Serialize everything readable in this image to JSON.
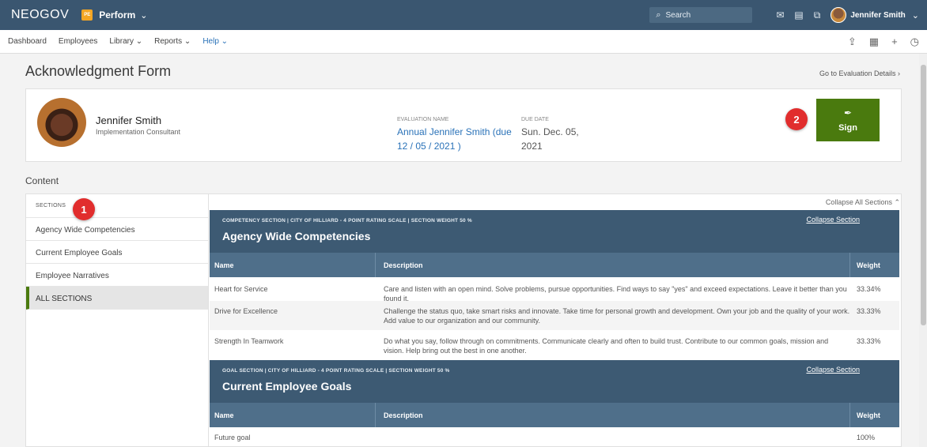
{
  "topbar": {
    "brand": "NEOGOV",
    "app_badge": "PE",
    "app_name": "Perform",
    "search_placeholder": "Search",
    "user_name": "Jennifer Smith"
  },
  "nav": {
    "items": [
      "Dashboard",
      "Employees",
      "Library",
      "Reports"
    ],
    "help": "Help"
  },
  "page": {
    "title": "Acknowledgment Form",
    "eval_link": "Go to Evaluation Details"
  },
  "employee": {
    "name": "Jennifer Smith",
    "role": "Implementation Consultant"
  },
  "evaluation": {
    "name_label": "EVALUATION NAME",
    "name_value": "Annual Jennifer Smith (due 12 / 05 / 2021 )",
    "due_label": "DUE DATE",
    "due_value": "Sun. Dec. 05, 2021"
  },
  "sign_label": "Sign",
  "badges": [
    "1",
    "2"
  ],
  "content_label": "Content",
  "sections_panel": {
    "header": "SECTIONS",
    "items": [
      "Agency Wide Competencies",
      "Current Employee Goals",
      "Employee Narratives",
      "ALL SECTIONS"
    ]
  },
  "collapse_all": "Collapse All Sections",
  "competency": {
    "subtitle": "COMPETENCY SECTION | CITY OF HILLIARD - 4 POINT RATING SCALE | SECTION WEIGHT 50 %",
    "title": "Agency Wide Competencies",
    "collapse": "Collapse Section",
    "columns": [
      "Name",
      "Description",
      "Weight"
    ],
    "rows": [
      {
        "name": "Heart for Service",
        "desc": "Care and listen with an open mind. Solve problems, pursue opportunities. Find ways to say \"yes\" and exceed expectations. Leave it better than you found it.",
        "weight": "33.34%"
      },
      {
        "name": "Drive for Excellence",
        "desc": "Challenge the status quo, take smart risks and innovate. Take time for personal growth and development. Own your job and the quality of your work. Add value to our organization and our community.",
        "weight": "33.33%"
      },
      {
        "name": "Strength In Teamwork",
        "desc": "Do what you say, follow through on commitments. Communicate clearly and often to build trust. Contribute to our common goals, mission and vision. Help bring out the best in one another.",
        "weight": "33.33%"
      }
    ]
  },
  "goals": {
    "subtitle": "GOAL SECTION | CITY OF HILLIARD - 4 POINT RATING SCALE | SECTION WEIGHT 50 %",
    "title": "Current Employee Goals",
    "collapse": "Collapse Section",
    "columns": [
      "Name",
      "Description",
      "Weight"
    ],
    "rows": [
      {
        "name": "Future goal",
        "desc": "",
        "weight": "100%"
      }
    ]
  },
  "icons": {
    "search": "search-icon",
    "mail": "mail-icon",
    "calendar": "calendar-icon",
    "export": "export-icon",
    "sign": "pen-nib-icon"
  }
}
